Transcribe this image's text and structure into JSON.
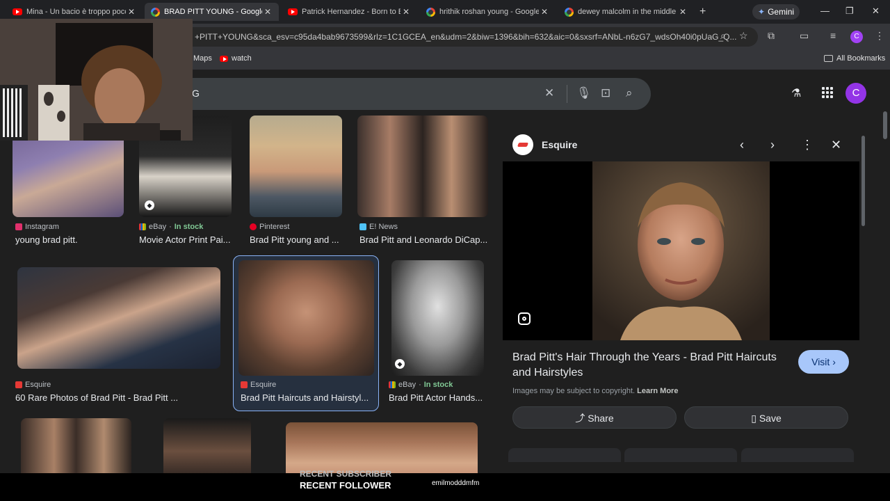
{
  "tabs": [
    {
      "title": "Mina - Un bacio è troppo poco",
      "icon": "youtube-icon",
      "active": false
    },
    {
      "title": "BRAD PITT YOUNG - Google Se",
      "icon": "google-icon",
      "active": true
    },
    {
      "title": "Patrick Hernandez - Born to Be",
      "icon": "youtube-icon",
      "active": false
    },
    {
      "title": "hrithik roshan young - Google",
      "icon": "google-icon",
      "active": false
    },
    {
      "title": "dewey malcolm in the middle a",
      "icon": "google-icon",
      "active": false
    }
  ],
  "gemini_label": "Gemini",
  "address": "+PITT+YOUNG&sca_esv=c95da4bab9673599&rlz=1C1GCEA_en&udm=2&biw=1396&bih=632&aic=0&sxsrf=ANbL-n6zG7_wdsOh40i0pUaG_Q...",
  "profile_initial": "C",
  "bookmarks": {
    "maps": "Maps",
    "watch": "watch",
    "all": "All Bookmarks"
  },
  "search": {
    "query_visible": "G"
  },
  "results": [
    {
      "source": "Instagram",
      "caption": "young brad pitt.",
      "stock": "",
      "logo_color": "#e1306c"
    },
    {
      "source": "eBay",
      "stock": "In stock",
      "caption": "Movie Actor Print Pai...",
      "logo_color": "#e53238"
    },
    {
      "source": "Pinterest",
      "caption": "Brad Pitt young and ...",
      "stock": "",
      "logo_color": "#e60023"
    },
    {
      "source": "E! News",
      "caption": "Brad Pitt and Leonardo DiCap...",
      "stock": "",
      "logo_color": "#4fc3f7"
    },
    {
      "source": "Esquire",
      "caption": "60 Rare Photos of Brad Pitt - Brad Pitt ...",
      "stock": "",
      "logo_color": "#e53935"
    },
    {
      "source": "Esquire",
      "caption": "Brad Pitt Haircuts and Hairstyl...",
      "stock": "",
      "logo_color": "#e53935"
    },
    {
      "source": "eBay",
      "stock": "In stock",
      "caption": "Brad Pitt Actor Hands...",
      "logo_color": "#e53238"
    }
  ],
  "panel": {
    "source": "Esquire",
    "title": "Brad Pitt's Hair Through the Years - Brad Pitt Haircuts and Hairstyles",
    "visit": "Visit",
    "copyright": "Images may be subject to copyright.",
    "learn_more": "Learn More",
    "share": "Share",
    "save": "Save"
  },
  "overlay": {
    "recent_subscriber": "RECENT SUBSCRIBER",
    "recent_follower": "RECENT FOLLOWER",
    "follower_name": "emilmodddmfm"
  }
}
